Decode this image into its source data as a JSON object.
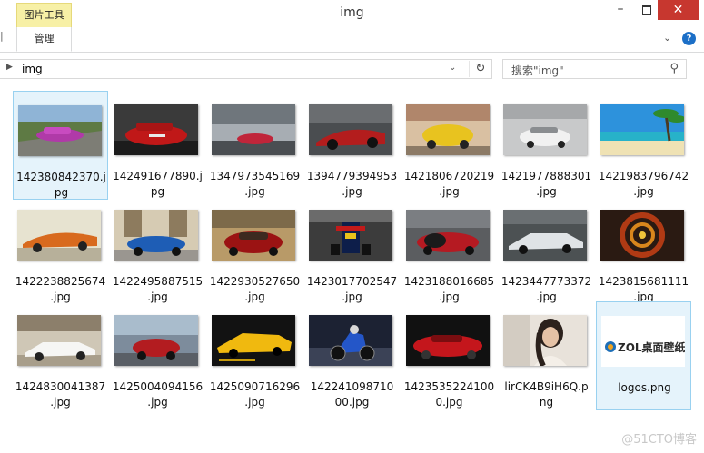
{
  "title_bar": {
    "context_tab": "图片工具",
    "window_title": "img",
    "minimize": "–",
    "close": "✕"
  },
  "ribbon": {
    "active_tab": "管理"
  },
  "address_bar": {
    "current_folder": "img",
    "search_placeholder": "搜索\"img\""
  },
  "files": [
    {
      "line1": "142380842370.j",
      "line2": "pg",
      "thumb": "purple-car-track",
      "selected": true
    },
    {
      "line1": "142491677890.j",
      "line2": "pg",
      "thumb": "red-camaro"
    },
    {
      "line1": "1347973545169",
      "line2": ".jpg",
      "thumb": "red-roadster-cloudy"
    },
    {
      "line1": "1394779394953",
      "line2": ".jpg",
      "thumb": "red-concept-dark"
    },
    {
      "line1": "1421806720219",
      "line2": ".jpg",
      "thumb": "yellow-beetle"
    },
    {
      "line1": "1421977888301",
      "line2": ".jpg",
      "thumb": "white-bugatti"
    },
    {
      "line1": "1421983796742",
      "line2": ".jpg",
      "thumb": "beach-palms"
    },
    {
      "line1": "1422238825674",
      "line2": ".jpg",
      "thumb": "orange-concept"
    },
    {
      "line1": "1422495887515",
      "line2": ".jpg",
      "thumb": "blue-sports-car"
    },
    {
      "line1": "1422930527650",
      "line2": ".jpg",
      "thumb": "red-mclaren"
    },
    {
      "line1": "1423017702547",
      "line2": ".jpg",
      "thumb": "f1-car"
    },
    {
      "line1": "1423188016685",
      "line2": ".jpg",
      "thumb": "red-bugatti-showroom"
    },
    {
      "line1": "1423447773372",
      "line2": ".jpg",
      "thumb": "silver-lamborghini"
    },
    {
      "line1": "1423815681111",
      "line2": ".jpg",
      "thumb": "abstract-spiral"
    },
    {
      "line1": "1424830041387",
      "line2": ".jpg",
      "thumb": "white-lamborghini"
    },
    {
      "line1": "1425004094156",
      "line2": ".jpg",
      "thumb": "red-car-street"
    },
    {
      "line1": "1425090716296",
      "line2": ".jpg",
      "thumb": "yellow-huracan"
    },
    {
      "line1": "142241098710",
      "line2": "00.jpg",
      "thumb": "motorcycle"
    },
    {
      "line1": "1423535224100",
      "line2": "0.jpg",
      "thumb": "red-coupe"
    },
    {
      "line1": "lirCK4B9iH6Q.p",
      "line2": "ng",
      "thumb": "woman-portrait"
    },
    {
      "line1": "logos.png",
      "line2": "",
      "thumb": "zol-logo",
      "selected": true,
      "logo_text": "ZOL桌面壁纸"
    }
  ],
  "watermark": "@51CTO博客"
}
